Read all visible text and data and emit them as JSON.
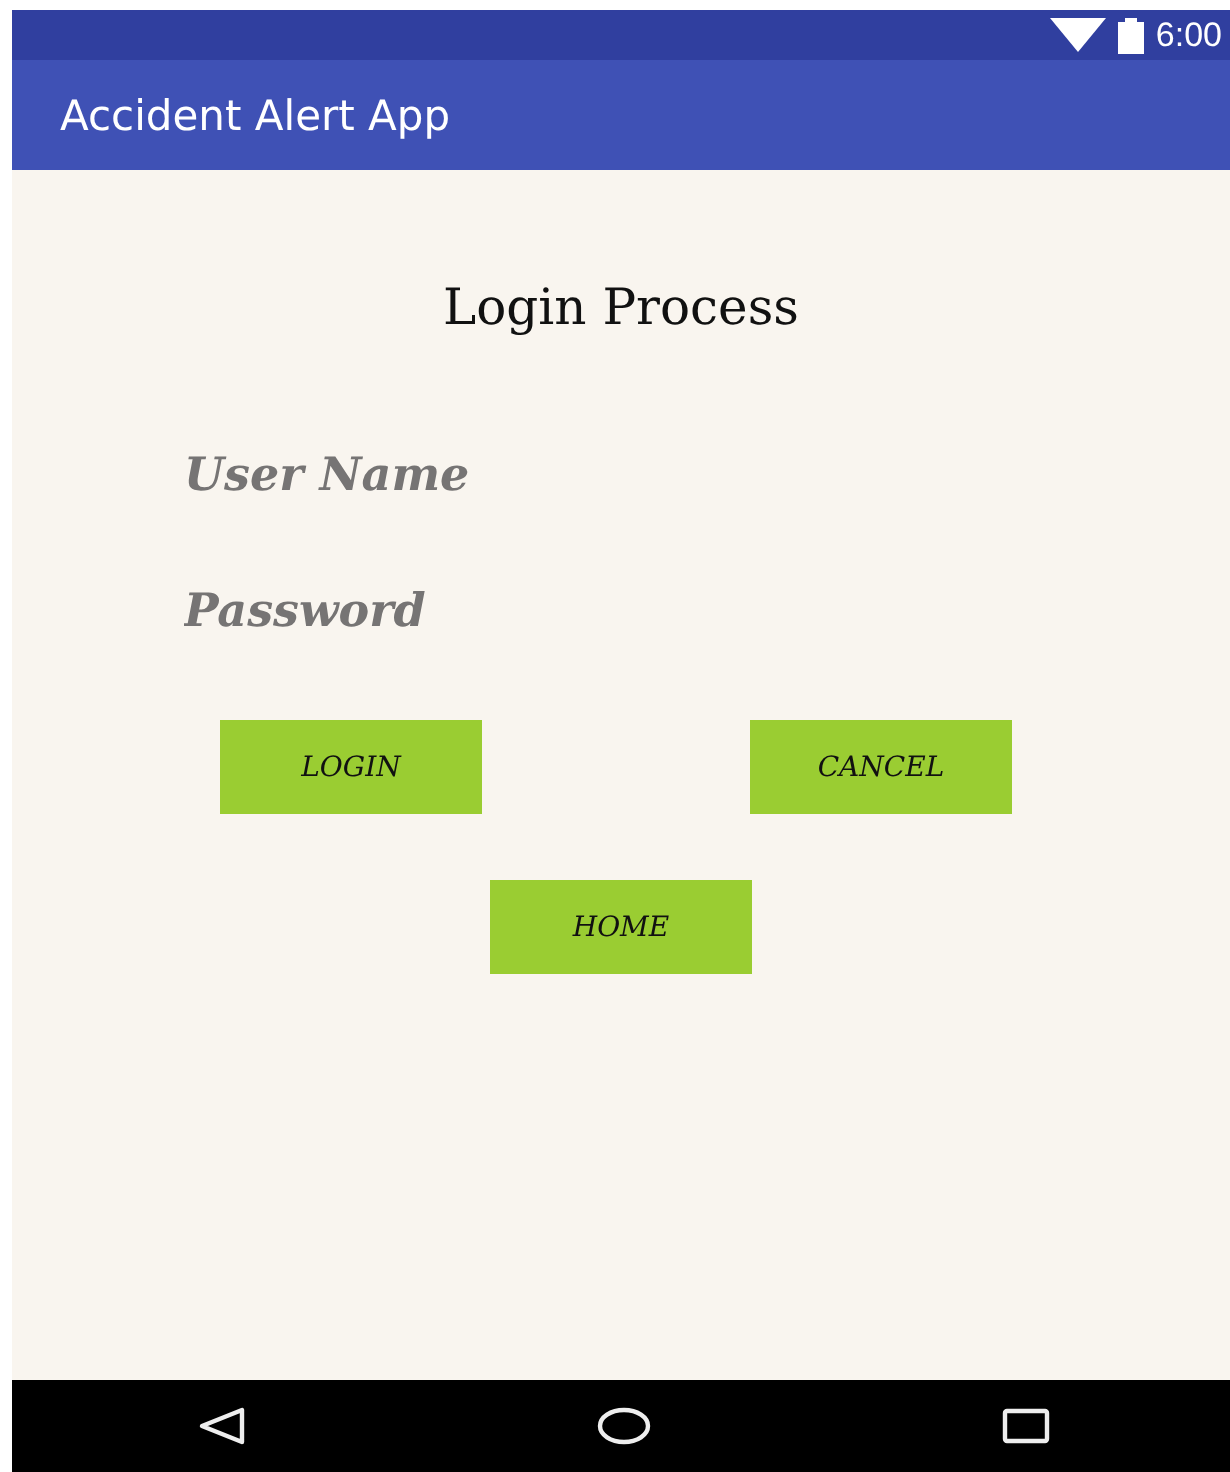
{
  "status_bar": {
    "time": "6:00"
  },
  "app_bar": {
    "title": "Accident Alert App"
  },
  "heading": "Login Process",
  "fields": [
    {
      "placeholder": "User Name"
    },
    {
      "placeholder": "Password"
    }
  ],
  "buttons": [
    {
      "label": "LOGIN"
    },
    {
      "label": "CANCEL"
    },
    {
      "label": "HOME"
    }
  ]
}
